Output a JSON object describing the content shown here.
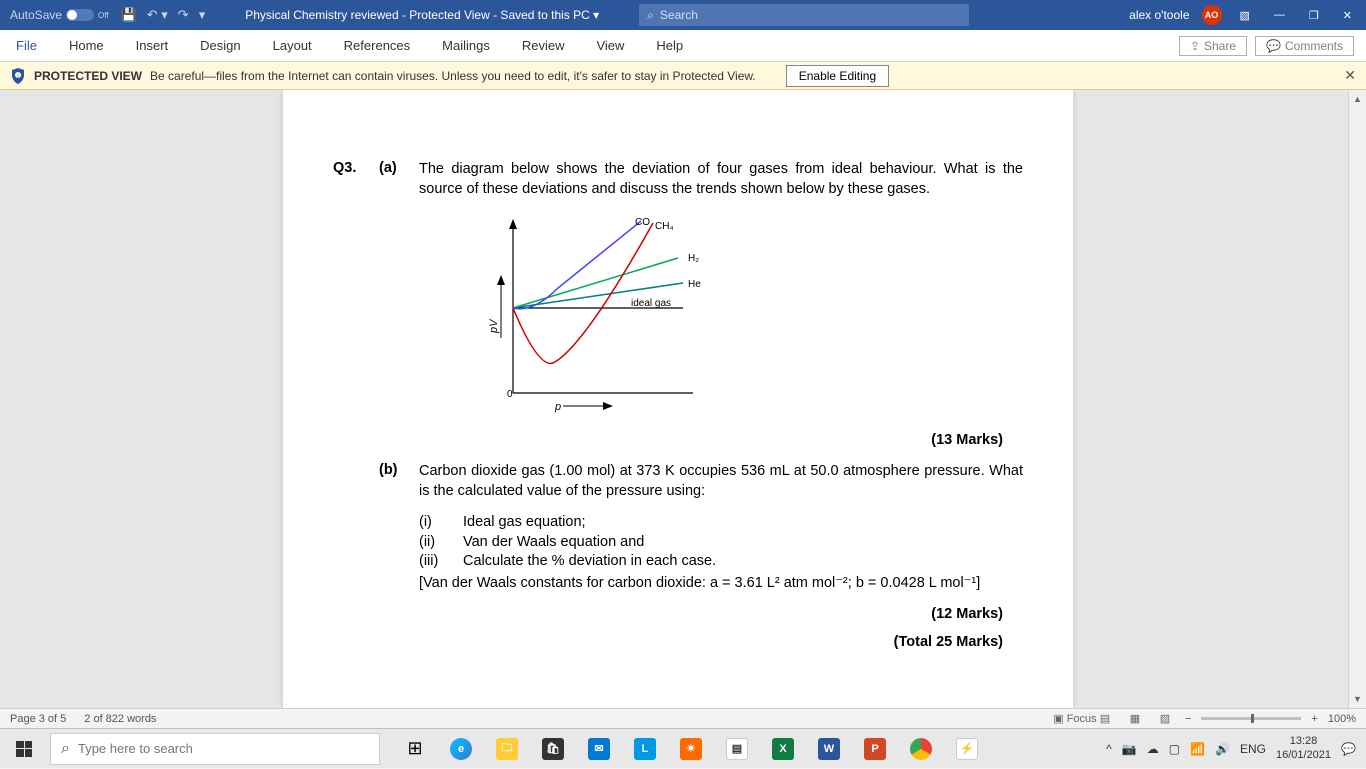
{
  "title_bar": {
    "autosave_label": "AutoSave",
    "autosave_state": "Off",
    "doc_title": "Physical Chemistry reviewed  -  Protected View  -  Saved to this PC ▾",
    "search_placeholder": "Search",
    "user_name": "alex o'toole",
    "user_initials": "AO",
    "ribbon_display": "▧",
    "minimize": "—",
    "restore": "❐",
    "close": "✕"
  },
  "ribbon": {
    "tabs": [
      "File",
      "Home",
      "Insert",
      "Design",
      "Layout",
      "References",
      "Mailings",
      "Review",
      "View",
      "Help"
    ],
    "share": "Share",
    "comments": "Comments"
  },
  "protected_view": {
    "label": "PROTECTED VIEW",
    "message": "Be careful—files from the Internet can contain viruses. Unless you need to edit, it's safer to stay in Protected View.",
    "enable": "Enable Editing"
  },
  "document": {
    "q3_num": "Q3.",
    "part_a": "(a)",
    "part_a_text": "The diagram below shows the deviation of four gases from ideal behaviour. What is the source of these deviations and discuss the trends shown below by these gases.",
    "part_a_marks": "(13 Marks)",
    "part_b": "(b)",
    "part_b_text": "Carbon dioxide gas (1.00 mol) at 373 K occupies 536 mL at 50.0 atmosphere pressure. What is the calculated value of the pressure using:",
    "sub_i": "(i)",
    "sub_i_text": "Ideal gas equation;",
    "sub_ii": "(ii)",
    "sub_ii_text": "Van der Waals equation and",
    "sub_iii": "(iii)",
    "sub_iii_text": "Calculate the % deviation in each case.",
    "vdw_constants": "[Van der Waals constants for carbon dioxide: a = 3.61 L² atm mol⁻²; b = 0.0428 L mol⁻¹]",
    "part_b_marks": "(12 Marks)",
    "total_marks": "(Total 25 Marks)"
  },
  "chart_data": {
    "type": "line",
    "title": "",
    "xlabel": "p",
    "ylabel": "pV",
    "series": [
      {
        "name": "CO",
        "color": "#4040ff",
        "shape": "monotone_increasing_steep"
      },
      {
        "name": "CH₄",
        "color": "#cc0000",
        "shape": "dip_then_rise_strong"
      },
      {
        "name": "H₂",
        "color": "#00aa50",
        "shape": "monotone_increasing_mild"
      },
      {
        "name": "He",
        "color": "#008080",
        "shape": "monotone_increasing_slight"
      },
      {
        "name": "ideal gas",
        "color": "#000000",
        "shape": "flat"
      }
    ],
    "axis_origin_label": "0"
  },
  "status_bar": {
    "page": "Page 3 of 5",
    "words": "2 of 822 words",
    "focus": "Focus",
    "zoom": "100%"
  },
  "taskbar": {
    "search_placeholder": "Type here to search",
    "lang": "ENG",
    "time": "13:28",
    "date": "16/01/2021"
  }
}
